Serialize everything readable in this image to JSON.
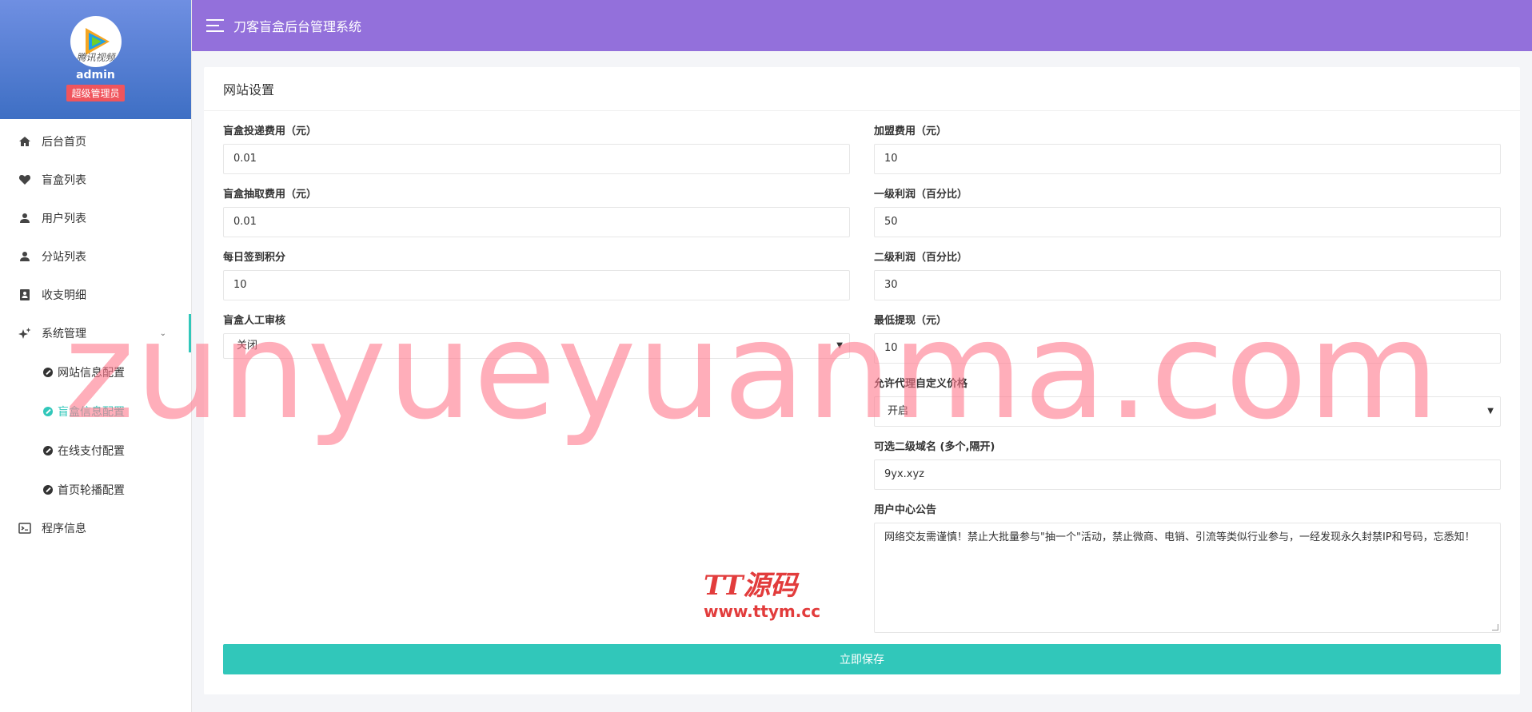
{
  "app": {
    "title": "刀客盲盒后台管理系统"
  },
  "profile": {
    "avatar_caption": "腾讯视频",
    "username": "admin",
    "role": "超级管理员"
  },
  "sidebar": {
    "items": [
      {
        "label": "后台首页",
        "icon": "home-icon"
      },
      {
        "label": "盲盒列表",
        "icon": "heart-icon"
      },
      {
        "label": "用户列表",
        "icon": "user-icon"
      },
      {
        "label": "分站列表",
        "icon": "user-icon"
      },
      {
        "label": "收支明细",
        "icon": "contact-icon"
      },
      {
        "label": "系统管理",
        "icon": "sparkle-icon"
      },
      {
        "label": "程序信息",
        "icon": "terminal-icon"
      }
    ],
    "submenu": [
      {
        "label": "网站信息配置"
      },
      {
        "label": "盲盒信息配置"
      },
      {
        "label": "在线支付配置"
      },
      {
        "label": "首页轮播配置"
      }
    ],
    "active_submenu": "盲盒信息配置"
  },
  "card": {
    "title": "网站设置"
  },
  "form": {
    "left": [
      {
        "label": "盲盒投递费用（元）",
        "value": "0.01"
      },
      {
        "label": "盲盒抽取费用（元）",
        "value": "0.01"
      },
      {
        "label": "每日签到积分",
        "value": "10"
      },
      {
        "label": "盲盒人工审核",
        "value": "关闭"
      }
    ],
    "right": [
      {
        "label": "加盟费用（元）",
        "value": "10"
      },
      {
        "label": "一级利润（百分比）",
        "value": "50"
      },
      {
        "label": "二级利润（百分比）",
        "value": "30"
      },
      {
        "label": "最低提现（元）",
        "value": "10"
      },
      {
        "label": "允许代理自定义价格",
        "value": "开启"
      },
      {
        "label": "可选二级域名 (多个,隔开)",
        "value": "9yx.xyz"
      },
      {
        "label": "用户中心公告",
        "value": "网络交友需谨慎！禁止大批量参与\"抽一个\"活动，禁止微商、电销、引流等类似行业参与，一经发现永久封禁IP和号码，忘悉知！"
      }
    ],
    "save_label": "立即保存"
  },
  "watermark": {
    "big_text": "zunyueyuanma.com",
    "logo_main": "TT源码",
    "logo_sub": "www.ttym.cc"
  },
  "colors": {
    "header": "#9370db",
    "accent": "#31c7ba",
    "badge": "#f0555d"
  }
}
